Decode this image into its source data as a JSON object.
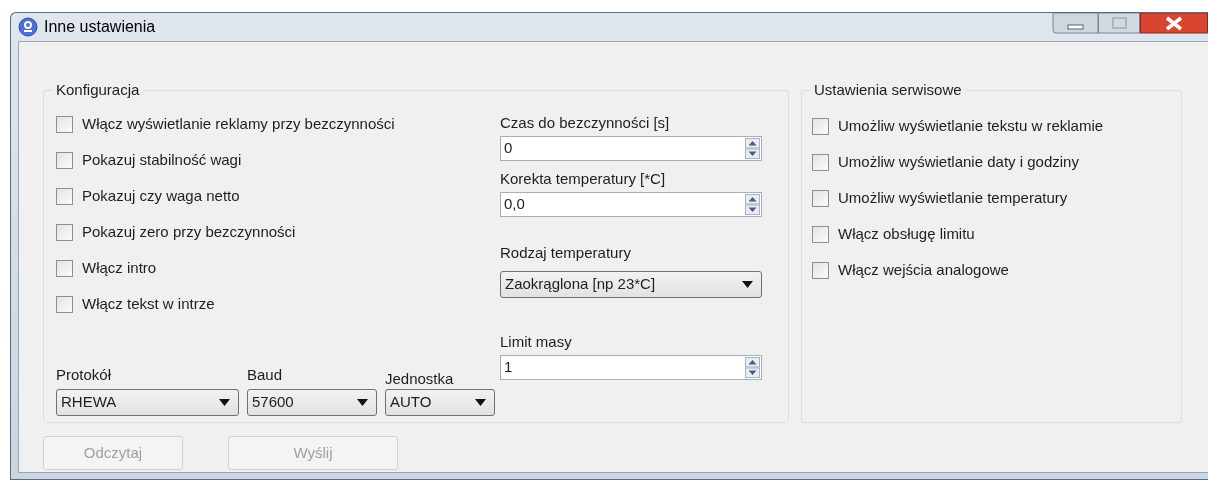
{
  "window": {
    "title": "Inne ustawienia"
  },
  "config": {
    "title": "Konfiguracja",
    "checkboxes": [
      {
        "label": "Włącz wyświetlanie reklamy przy bezczynności",
        "checked": false
      },
      {
        "label": "Pokazuj stabilność wagi",
        "checked": false
      },
      {
        "label": "Pokazuj czy waga netto",
        "checked": false
      },
      {
        "label": "Pokazuj zero przy bezczynności",
        "checked": false
      },
      {
        "label": "Włącz intro",
        "checked": false
      },
      {
        "label": "Włącz tekst w intrze",
        "checked": false
      }
    ],
    "fields": [
      {
        "kind": "spin",
        "label": "Czas do bezczynności [s]",
        "value": "0"
      },
      {
        "kind": "spin",
        "label": "Korekta temperatury [*C]",
        "value": "0,0"
      },
      {
        "kind": "combo",
        "label": "Rodzaj temperatury",
        "value": "Zaokrąglona [np 23*C]"
      },
      {
        "kind": "spin",
        "label": "Limit masy",
        "value": "1"
      }
    ],
    "bottom": [
      {
        "kind": "combo",
        "label": "Protokół",
        "value": "RHEWA"
      },
      {
        "kind": "combo",
        "label": "Baud",
        "value": "57600"
      },
      {
        "kind": "combo",
        "label": "Jednostka",
        "value": "AUTO"
      }
    ]
  },
  "service": {
    "title": "Ustawienia serwisowe",
    "checkboxes": [
      {
        "label": "Umożliw wyświetlanie tekstu w reklamie",
        "checked": false
      },
      {
        "label": "Umożliw wyświetlanie daty i godziny",
        "checked": false
      },
      {
        "label": "Umożliw wyświetlanie temperatury",
        "checked": false
      },
      {
        "label": "Włącz obsługę limitu",
        "checked": false
      },
      {
        "label": "Włącz wejścia analogowe",
        "checked": false
      }
    ]
  },
  "buttons": [
    {
      "label": "Odczytaj",
      "disabled": true
    },
    {
      "label": "Wyślij",
      "disabled": true
    }
  ]
}
